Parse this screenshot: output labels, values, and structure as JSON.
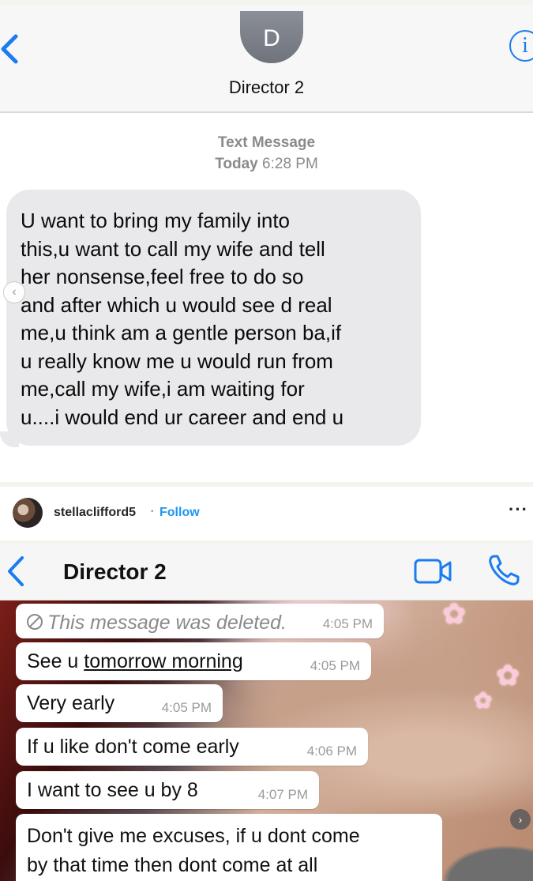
{
  "imessage": {
    "contact_initial": "D",
    "contact_name": "Director 2",
    "info_glyph": "i",
    "message_type": "Text Message",
    "day": "Today",
    "time": "6:28 PM",
    "message_lines": [
      "U want to bring my family into",
      "this,u want to call my wife and tell",
      "her nonsense,feel free to do so",
      "and after which u would see d real",
      "me,u think am a gentle person ba,if",
      "u really know me u would run from",
      "me,call my wife,i am waiting for",
      "u....i would end ur career and end u"
    ]
  },
  "instagram": {
    "username": "stellaclifford5",
    "separator": "·",
    "follow_label": "Follow",
    "more_label": "···"
  },
  "whatsapp": {
    "contact_name": "Director 2",
    "messages": [
      {
        "text": "This message was deleted.",
        "time": "4:05 PM",
        "deleted": true
      },
      {
        "text_plain": "See u ",
        "text_link": "tomorrow morning",
        "time": "4:05 PM"
      },
      {
        "text": "Very early",
        "time": "4:05 PM"
      },
      {
        "text": "If u like don't come early",
        "time": "4:06 PM"
      },
      {
        "text": "I want to see u by 8",
        "time": "4:07 PM"
      },
      {
        "lines": [
          "Don't give me excuses, if u dont come",
          "by that time then dont come at all"
        ]
      }
    ]
  },
  "colors": {
    "ios_blue": "#1a7cf0",
    "imessage_bubble": "#e9e9eb",
    "instagram_follow": "#1e96f0",
    "whatsapp_bubble": "#ffffff"
  },
  "icons": [
    "back-chevron-icon",
    "info-icon",
    "deleted-icon",
    "video-call-icon",
    "phone-icon",
    "more-icon"
  ]
}
